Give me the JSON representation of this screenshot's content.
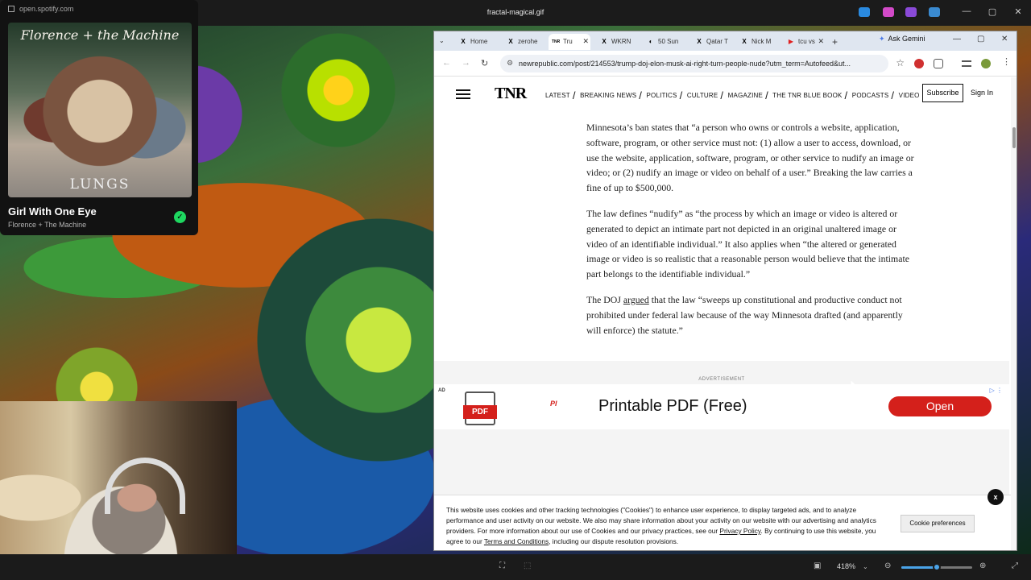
{
  "viewer": {
    "title": "fractal-magical.gif",
    "zoom_label": "418%",
    "zoom_fraction": 0.5
  },
  "spotify": {
    "url": "open.spotify.com",
    "album_title": "Florence + the Machine",
    "album_subtitle": "LUNGS",
    "track": "Girl With One Eye",
    "artist": "Florence + The Machine",
    "liked_glyph": "✓"
  },
  "browser": {
    "tabs": [
      {
        "icon": "X",
        "label": "Home"
      },
      {
        "icon": "X",
        "label": "zerohe"
      },
      {
        "icon": "TNR",
        "label": "Tru"
      },
      {
        "icon": "X",
        "label": "WKRN"
      },
      {
        "icon": "◐",
        "label": "50 Sun"
      },
      {
        "icon": "X",
        "label": "Qatar T"
      },
      {
        "icon": "X",
        "label": "Nick M"
      },
      {
        "icon": "▶",
        "label": "tcu vs"
      }
    ],
    "new_tab": "+",
    "gemini_label": "Ask Gemini",
    "url": "newrepublic.com/post/214553/trump-doj-elon-musk-ai-right-turn-people-nude?utm_term=Autofeed&ut..."
  },
  "site": {
    "logo": "TNR",
    "nav": [
      "LATEST",
      "BREAKING NEWS",
      "POLITICS",
      "CULTURE",
      "MAGAZINE",
      "THE TNR BLUE BOOK",
      "PODCASTS",
      "VIDEO"
    ],
    "subscribe": "Subscribe",
    "signin": "Sign In"
  },
  "article": {
    "p1": "Minnesota’s ban states that “a person who owns or controls a website, application, software, program, or other service must not: (1) allow a user to access, download, or use the website, application, software, program, or other service to nudify an image or video; or (2) nudify an image or video on behalf of a user.” Breaking the law carries a fine of up to $500,000.",
    "p2": "The law defines “nudify” as “the process by which an image or video is altered or generated to depict an intimate part not depicted in an original unaltered image or video of an identifiable individual.” It also applies when “the altered or generated image or video is so realistic that a reasonable person would believe that the intimate part belongs to the identifiable individual.”",
    "p3_a": "The DOJ ",
    "p3_link": "argued",
    "p3_b": " that the law “sweeps up constitutional and productive conduct not prohibited under federal law because of the way Minnesota drafted (and apparently will enforce) the statute.”"
  },
  "ad": {
    "section_label": "ADVERTISEMENT",
    "tag": "AD",
    "pdf_badge": "PDF",
    "brand": "Pl",
    "headline": "Printable PDF (Free)",
    "cta": "Open"
  },
  "cookie": {
    "text_a": "This website uses cookies and other tracking technologies (\"Cookies\") to enhance user experience, to display targeted ads, and to analyze performance and user activity on our website. We also may share information about your activity on our website with our advertising and analytics providers. For more information about our use of Cookies and our privacy practices, see our ",
    "privacy_link": "Privacy Policy",
    "text_b": ". By continuing to use this website, you agree to our ",
    "terms_link": "Terms and Conditions",
    "text_c": ", including our dispute resolution provisions.",
    "prefs_button": "Cookie preferences",
    "close": "x"
  }
}
